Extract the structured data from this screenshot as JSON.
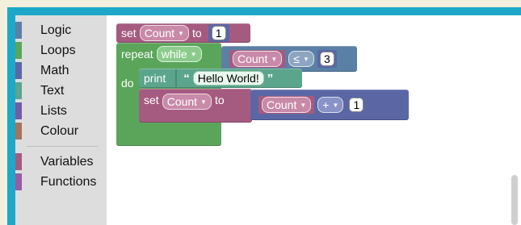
{
  "toolbox": {
    "categories": [
      {
        "label": "Logic",
        "color": "#5b80a5"
      },
      {
        "label": "Loops",
        "color": "#5ba55b"
      },
      {
        "label": "Math",
        "color": "#5b67a5"
      },
      {
        "label": "Text",
        "color": "#5ba58c"
      },
      {
        "label": "Lists",
        "color": "#745ba5"
      },
      {
        "label": "Colour",
        "color": "#a5745b"
      },
      {
        "label": "Variables",
        "color": "#a55b80"
      },
      {
        "label": "Functions",
        "color": "#995ba5"
      }
    ]
  },
  "blocks": {
    "set1": {
      "label_set": "set",
      "var": "Count",
      "label_to": "to",
      "value": "1"
    },
    "repeat": {
      "label_repeat": "repeat",
      "mode": "while",
      "label_do": "do"
    },
    "compare": {
      "var": "Count",
      "op": "≤",
      "value": "3"
    },
    "print": {
      "label": "print",
      "open_quote": "“",
      "text": "Hello World!",
      "close_quote": "”"
    },
    "set2": {
      "label_set": "set",
      "var": "Count",
      "label_to": "to"
    },
    "arith": {
      "var": "Count",
      "op": "+",
      "value": "1"
    }
  },
  "colors": {
    "variables": "#a55b80",
    "loops": "#5ba55b",
    "logic": "#5b80a5",
    "math": "#5b67a5",
    "text": "#5ba58c",
    "frame": "#1da8c9"
  },
  "icons": {
    "dropdown": "chevron-down-icon"
  }
}
